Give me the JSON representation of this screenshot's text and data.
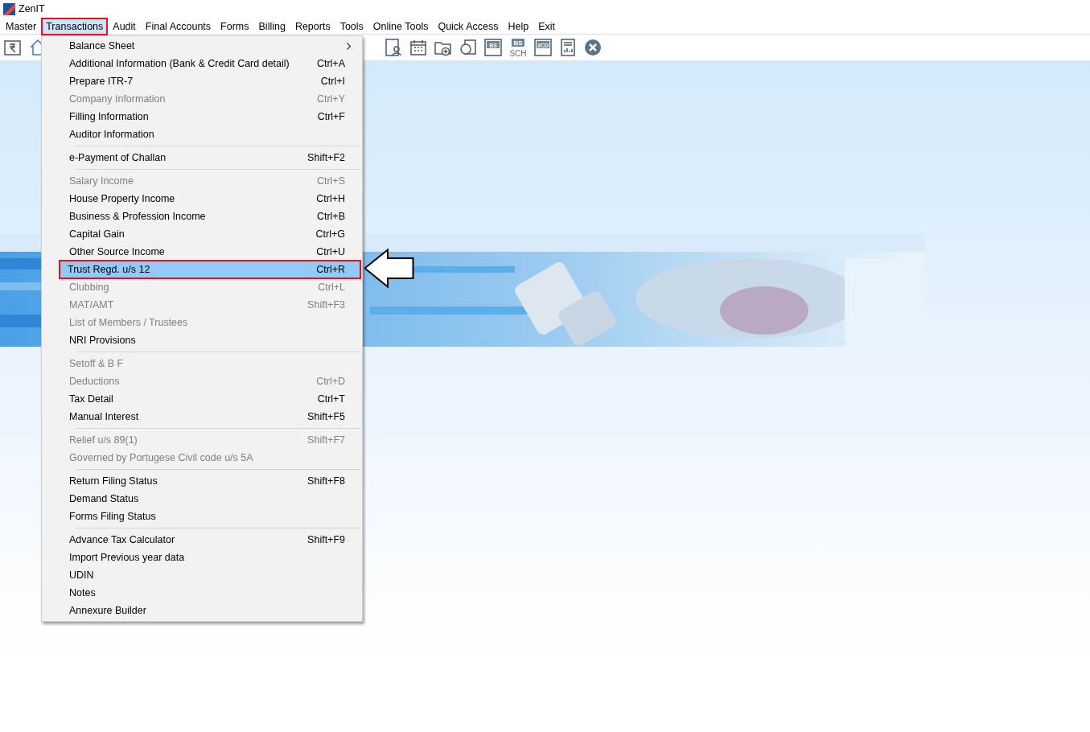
{
  "window": {
    "title": "ZenIT"
  },
  "menubar": [
    {
      "label": "Master",
      "selected": false,
      "outlined": false
    },
    {
      "label": "Transactions",
      "selected": true,
      "outlined": true
    },
    {
      "label": "Audit",
      "selected": false,
      "outlined": false
    },
    {
      "label": "Final Accounts",
      "selected": false,
      "outlined": false
    },
    {
      "label": "Forms",
      "selected": false,
      "outlined": false
    },
    {
      "label": "Billing",
      "selected": false,
      "outlined": false
    },
    {
      "label": "Reports",
      "selected": false,
      "outlined": false
    },
    {
      "label": "Tools",
      "selected": false,
      "outlined": false
    },
    {
      "label": "Online Tools",
      "selected": false,
      "outlined": false
    },
    {
      "label": "Quick Access",
      "selected": false,
      "outlined": false
    },
    {
      "label": "Help",
      "selected": false,
      "outlined": false
    },
    {
      "label": "Exit",
      "selected": false,
      "outlined": false
    }
  ],
  "toolbar": {
    "left": [
      {
        "kind": "rupee"
      },
      {
        "kind": "home"
      }
    ],
    "right": [
      {
        "kind": "user-doc"
      },
      {
        "kind": "calendar"
      },
      {
        "kind": "folder-add"
      },
      {
        "kind": "circle-doc"
      },
      {
        "kind": "text",
        "label": "BS"
      },
      {
        "kind": "text2",
        "label": "BS",
        "sublabel": "SCH"
      },
      {
        "kind": "text",
        "label": "3CD"
      },
      {
        "kind": "report"
      },
      {
        "kind": "close"
      }
    ]
  },
  "menu": {
    "sections": [
      [
        {
          "label": "Balance Sheet",
          "submenu": true,
          "disabled": false,
          "selected": false,
          "outlined": false
        },
        {
          "label": "Additional Information (Bank & Credit Card detail)",
          "shortcut": "Ctrl+A",
          "disabled": false,
          "selected": false,
          "outlined": false
        },
        {
          "label": "Prepare ITR-7",
          "shortcut": "Ctrl+I",
          "disabled": false,
          "selected": false,
          "outlined": false
        },
        {
          "label": "Company Information",
          "shortcut": "Ctrl+Y",
          "disabled": true,
          "selected": false,
          "outlined": false
        },
        {
          "label": "Filling Information",
          "shortcut": "Ctrl+F",
          "disabled": false,
          "selected": false,
          "outlined": false
        },
        {
          "label": "Auditor Information",
          "disabled": false,
          "selected": false,
          "outlined": false
        }
      ],
      [
        {
          "label": "e-Payment of Challan",
          "shortcut": "Shift+F2",
          "disabled": false,
          "selected": false,
          "outlined": false
        }
      ],
      [
        {
          "label": "Salary Income",
          "shortcut": "Ctrl+S",
          "disabled": true,
          "selected": false,
          "outlined": false
        },
        {
          "label": "House Property Income",
          "shortcut": "Ctrl+H",
          "disabled": false,
          "selected": false,
          "outlined": false
        },
        {
          "label": "Business & Profession Income",
          "shortcut": "Ctrl+B",
          "disabled": false,
          "selected": false,
          "outlined": false
        },
        {
          "label": "Capital Gain",
          "shortcut": "Ctrl+G",
          "disabled": false,
          "selected": false,
          "outlined": false
        },
        {
          "label": "Other Source Income",
          "shortcut": "Ctrl+U",
          "disabled": false,
          "selected": false,
          "outlined": false
        },
        {
          "label": "Trust Regd. u/s 12",
          "shortcut": "Ctrl+R",
          "disabled": false,
          "selected": true,
          "outlined": true
        },
        {
          "label": "Clubbing",
          "shortcut": "Ctrl+L",
          "disabled": true,
          "selected": false,
          "outlined": false
        },
        {
          "label": "MAT/AMT",
          "shortcut": "Shift+F3",
          "disabled": true,
          "selected": false,
          "outlined": false
        },
        {
          "label": "List of Members / Trustees",
          "disabled": true,
          "selected": false,
          "outlined": false
        },
        {
          "label": "NRI Provisions",
          "disabled": false,
          "selected": false,
          "outlined": false
        }
      ],
      [
        {
          "label": "Setoff & B F",
          "disabled": true,
          "selected": false,
          "outlined": false
        },
        {
          "label": "Deductions",
          "shortcut": "Ctrl+D",
          "disabled": true,
          "selected": false,
          "outlined": false
        },
        {
          "label": "Tax Detail",
          "shortcut": "Ctrl+T",
          "disabled": false,
          "selected": false,
          "outlined": false
        },
        {
          "label": "Manual Interest",
          "shortcut": "Shift+F5",
          "disabled": false,
          "selected": false,
          "outlined": false
        }
      ],
      [
        {
          "label": "Relief u/s 89(1)",
          "shortcut": "Shift+F7",
          "disabled": true,
          "selected": false,
          "outlined": false
        },
        {
          "label": "Governed by Portugese Civil code u/s 5A",
          "disabled": true,
          "selected": false,
          "outlined": false
        }
      ],
      [
        {
          "label": "Return Filing Status",
          "shortcut": "Shift+F8",
          "disabled": false,
          "selected": false,
          "outlined": false
        },
        {
          "label": "Demand Status",
          "disabled": false,
          "selected": false,
          "outlined": false
        },
        {
          "label": "Forms Filing Status",
          "disabled": false,
          "selected": false,
          "outlined": false
        }
      ],
      [
        {
          "label": "Advance Tax Calculator",
          "shortcut": "Shift+F9",
          "disabled": false,
          "selected": false,
          "outlined": false
        },
        {
          "label": "Import Previous year data",
          "disabled": false,
          "selected": false,
          "outlined": false
        },
        {
          "label": "UDIN",
          "disabled": false,
          "selected": false,
          "outlined": false
        },
        {
          "label": "Notes",
          "disabled": false,
          "selected": false,
          "outlined": false
        },
        {
          "label": "Annexure Builder",
          "disabled": false,
          "selected": false,
          "outlined": false
        }
      ]
    ]
  },
  "callout_arrow": true
}
